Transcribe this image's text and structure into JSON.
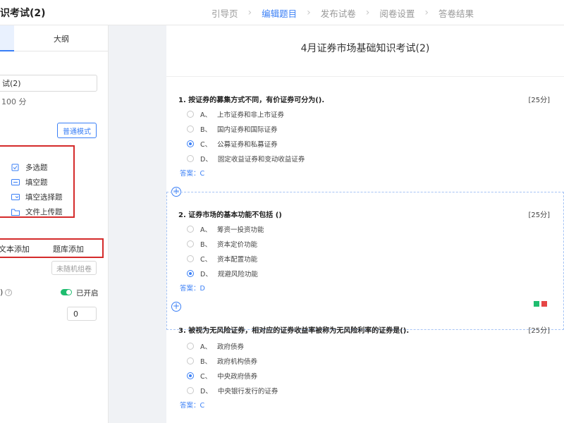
{
  "header": {
    "title": "识考试(2)",
    "steps": [
      "引导页",
      "编辑题目",
      "发布试卷",
      "阅卷设置",
      "答卷结果"
    ],
    "active_step": 1
  },
  "left_panel": {
    "tab_outline": "大纲",
    "exam_name_value": "试(2)",
    "total_score_text": "100 分",
    "mode_button": "普通模式",
    "question_types": [
      {
        "label": "多选题",
        "icon": "multi-choice-icon"
      },
      {
        "label": "填空题",
        "icon": "fill-blank-icon"
      },
      {
        "label": "填空选择题",
        "icon": "fill-select-icon"
      },
      {
        "label": "文件上传题",
        "icon": "folder-icon"
      }
    ],
    "add_text": "文本添加",
    "add_bank": "题库添加",
    "random_button": "未随机组卷",
    "setting_fragment": ")",
    "toggle_label": "已开启",
    "number_value": "0"
  },
  "paper": {
    "title": "4月证券市场基础知识考试(2)",
    "answer_prefix": "答案：",
    "questions": [
      {
        "title": "1. 按证券的募集方式不同，有价证券可分为().",
        "score": "[25分]",
        "options": [
          {
            "letter": "A、",
            "text": "上市证券和非上市证券"
          },
          {
            "letter": "B、",
            "text": "国内证券和国际证券"
          },
          {
            "letter": "C、",
            "text": "公募证券和私募证券"
          },
          {
            "letter": "D、",
            "text": "固定收益证券和变动收益证券"
          }
        ],
        "selected": 2,
        "answer": "C"
      },
      {
        "title": "2. 证券市场的基本功能不包括 ()",
        "score": "[25分]",
        "options": [
          {
            "letter": "A、",
            "text": "筹资一投资功能"
          },
          {
            "letter": "B、",
            "text": "资本定价功能"
          },
          {
            "letter": "C、",
            "text": "资本配置功能"
          },
          {
            "letter": "D、",
            "text": "规避风险功能"
          }
        ],
        "selected": 3,
        "answer": "D"
      },
      {
        "title": "3. 被视为无风险证券，相对应的证券收益率被称为无风险利率的证券是().",
        "score": "[25分]",
        "options": [
          {
            "letter": "A、",
            "text": "政府债券"
          },
          {
            "letter": "B、",
            "text": "政府机构债券"
          },
          {
            "letter": "C、",
            "text": "中央政府债券"
          },
          {
            "letter": "D、",
            "text": "中央银行发行的证券"
          }
        ],
        "selected": 2,
        "answer": "C"
      }
    ],
    "add_symbol": "+"
  },
  "colors": {
    "accent": "#3a7ff6",
    "highlight_border": "#d42b2b",
    "toggle_on": "#1fbd6f"
  }
}
